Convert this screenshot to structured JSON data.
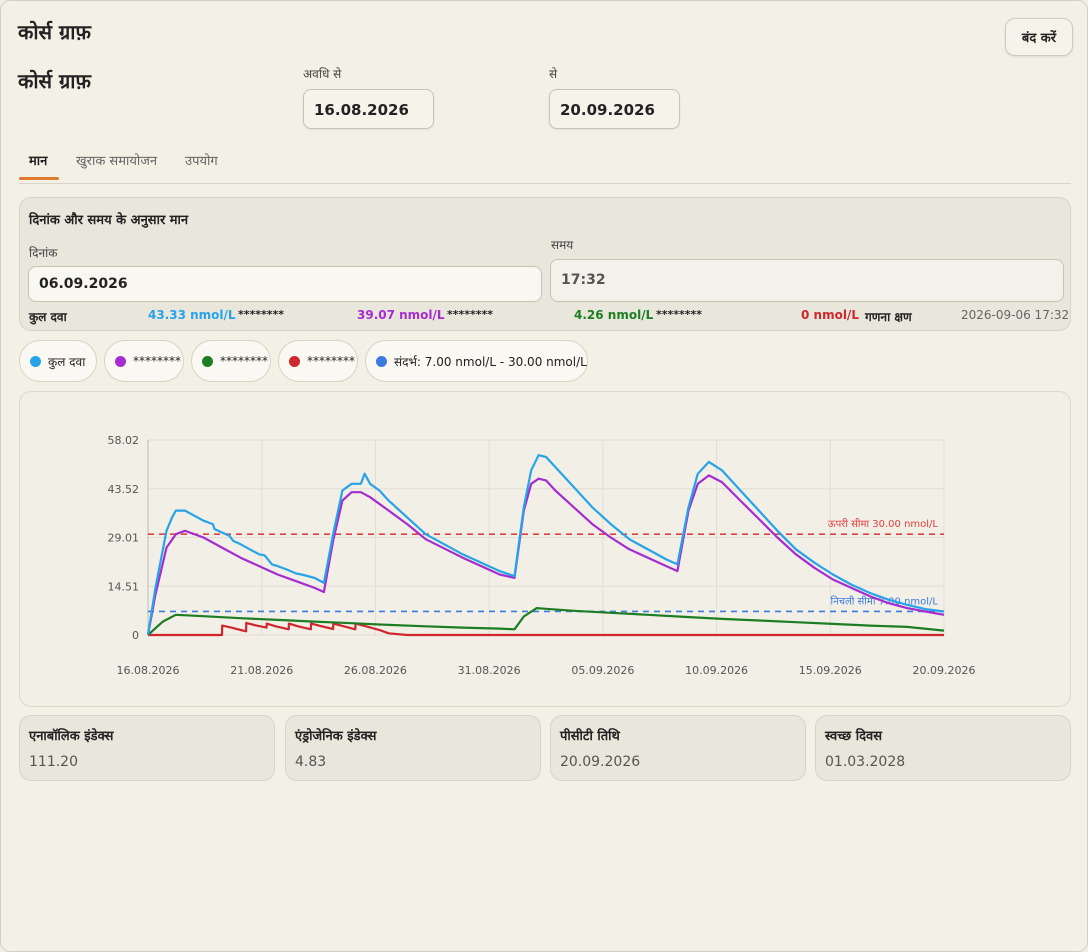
{
  "window": {
    "title": "कोर्स ग्राफ़",
    "close_label": "बंद करें"
  },
  "page_title": "कोर्स ग्राफ़",
  "period": {
    "from_label": "अवधि से",
    "from_value": "16.08.2026",
    "to_label": "से",
    "to_value": "20.09.2026"
  },
  "tabs": [
    {
      "label": "मान"
    },
    {
      "label": "खुराक समायोजन"
    },
    {
      "label": "उपयोग"
    }
  ],
  "values_panel": {
    "title": "दिनांक और समय के अनुसार मान",
    "date_label": "दिनांक",
    "date_value": "06.09.2026",
    "time_label": "समय",
    "time_value": "17:32",
    "total_label": "कुल दवा",
    "total_value": "43.33 nmol/L",
    "s1_name": "********",
    "s1_value": "39.07 nmol/L",
    "s2_name": "********",
    "s2_value": "4.26 nmol/L",
    "s3_name": "********",
    "s3_value": "0 nmol/L",
    "calc_label": "गणना क्षण",
    "calc_value": "2026-09-06 17:32"
  },
  "legend": [
    {
      "label": "कुल दवा",
      "color": "#27a3e8"
    },
    {
      "label": "********",
      "color": "#a52ccf"
    },
    {
      "label": "********",
      "color": "#1c7d23"
    },
    {
      "label": "********",
      "color": "#d0262d"
    },
    {
      "label": "संदर्भ: 7.00 nmol/L - 30.00 nmol/L",
      "color": "#3b7be0"
    }
  ],
  "chart_data": {
    "type": "line",
    "x_ticks": [
      "16.08.2026",
      "21.08.2026",
      "26.08.2026",
      "31.08.2026",
      "05.09.2026",
      "10.09.2026",
      "15.09.2026",
      "20.09.2026"
    ],
    "y_ticks": [
      "58.02",
      "43.52",
      "29.01",
      "14.51",
      "0"
    ],
    "ylim": [
      0,
      58.02
    ],
    "xlim_days": [
      0,
      36
    ],
    "upper_ref": {
      "value": 30.0,
      "label": "ऊपरी सीमा 30.00 nmol/L",
      "color": "#e04040"
    },
    "lower_ref": {
      "value": 7.0,
      "label": "निचली सीमा 7.00 nmol/L",
      "color": "#3b7be0"
    },
    "series": [
      {
        "name": "कुल दवा",
        "color": "#27a3e8",
        "points": [
          [
            0,
            0
          ],
          [
            0.4,
            14
          ],
          [
            1,
            31
          ],
          [
            1.3,
            35
          ],
          [
            1.5,
            37
          ],
          [
            2,
            37
          ],
          [
            3,
            34
          ],
          [
            3.5,
            33
          ],
          [
            3.6,
            31.5
          ],
          [
            4,
            30.5
          ],
          [
            4.4,
            29.5
          ],
          [
            4.6,
            28
          ],
          [
            5,
            27
          ],
          [
            5.5,
            25.5
          ],
          [
            6,
            24
          ],
          [
            6.3,
            23.7
          ],
          [
            6.7,
            21
          ],
          [
            7,
            20.5
          ],
          [
            7.5,
            19.5
          ],
          [
            8,
            18.3
          ],
          [
            8.3,
            18
          ],
          [
            9,
            17
          ],
          [
            9.5,
            15.5
          ],
          [
            10,
            30
          ],
          [
            10.5,
            43
          ],
          [
            11,
            45
          ],
          [
            11.5,
            45
          ],
          [
            11.7,
            48
          ],
          [
            12,
            45
          ],
          [
            12.5,
            43
          ],
          [
            13,
            40
          ],
          [
            14,
            35
          ],
          [
            15,
            30
          ],
          [
            17,
            24
          ],
          [
            19,
            19
          ],
          [
            19.8,
            17.5
          ],
          [
            20.3,
            38
          ],
          [
            20.7,
            49
          ],
          [
            21.1,
            53.5
          ],
          [
            21.5,
            53
          ],
          [
            22,
            50
          ],
          [
            23,
            44
          ],
          [
            24,
            38
          ],
          [
            25,
            33
          ],
          [
            26,
            28.5
          ],
          [
            28,
            22.5
          ],
          [
            28.6,
            21
          ],
          [
            29.2,
            38
          ],
          [
            29.7,
            48
          ],
          [
            30.3,
            51.5
          ],
          [
            31,
            49
          ],
          [
            32,
            43
          ],
          [
            33,
            37
          ],
          [
            34,
            31
          ],
          [
            35,
            25.5
          ],
          [
            36,
            21.5
          ],
          [
            37,
            18
          ],
          [
            38,
            15
          ],
          [
            39,
            12.5
          ],
          [
            40,
            10.5
          ],
          [
            41,
            9
          ],
          [
            42,
            7.7
          ],
          [
            43,
            7
          ]
        ]
      },
      {
        "name": "********",
        "color": "#a52ccf",
        "points": [
          [
            0,
            0
          ],
          [
            0.4,
            12
          ],
          [
            1,
            26
          ],
          [
            1.5,
            30
          ],
          [
            2,
            31
          ],
          [
            3,
            29
          ],
          [
            4,
            26
          ],
          [
            5,
            23
          ],
          [
            6,
            20.5
          ],
          [
            7,
            18
          ],
          [
            8,
            16
          ],
          [
            9,
            14
          ],
          [
            9.5,
            12.8
          ],
          [
            10,
            28
          ],
          [
            10.5,
            40
          ],
          [
            11,
            42.5
          ],
          [
            11.5,
            42.5
          ],
          [
            12,
            41
          ],
          [
            13,
            37
          ],
          [
            14,
            33
          ],
          [
            15,
            28.5
          ],
          [
            17,
            23
          ],
          [
            19,
            18
          ],
          [
            19.8,
            17
          ],
          [
            20.3,
            37
          ],
          [
            20.7,
            45
          ],
          [
            21.1,
            46.5
          ],
          [
            21.5,
            46
          ],
          [
            22,
            43
          ],
          [
            23,
            38
          ],
          [
            24,
            33
          ],
          [
            25,
            29
          ],
          [
            26,
            25.5
          ],
          [
            28,
            20.5
          ],
          [
            28.6,
            19
          ],
          [
            29.2,
            37
          ],
          [
            29.7,
            45
          ],
          [
            30.3,
            47.5
          ],
          [
            31,
            45.5
          ],
          [
            32,
            40
          ],
          [
            33,
            34.5
          ],
          [
            34,
            29
          ],
          [
            35,
            24
          ],
          [
            36,
            20
          ],
          [
            37,
            16.5
          ],
          [
            38,
            14
          ],
          [
            39,
            11.5
          ],
          [
            40,
            9.5
          ],
          [
            41,
            8
          ],
          [
            42,
            7
          ],
          [
            43,
            6
          ]
        ]
      },
      {
        "name": "********",
        "color": "#1c7d23",
        "points": [
          [
            0,
            0
          ],
          [
            0.8,
            4
          ],
          [
            1.5,
            6
          ],
          [
            3,
            5.6
          ],
          [
            5,
            5
          ],
          [
            7,
            4.5
          ],
          [
            9,
            4
          ],
          [
            11,
            3.5
          ],
          [
            13,
            3
          ],
          [
            15,
            2.6
          ],
          [
            17,
            2.2
          ],
          [
            19,
            1.9
          ],
          [
            19.8,
            1.7
          ],
          [
            20.3,
            5.5
          ],
          [
            21,
            8
          ],
          [
            21.5,
            7.8
          ],
          [
            23,
            7.2
          ],
          [
            25,
            6.6
          ],
          [
            27,
            6
          ],
          [
            29,
            5.4
          ],
          [
            31,
            4.8
          ],
          [
            33,
            4.3
          ],
          [
            35,
            3.8
          ],
          [
            37,
            3.3
          ],
          [
            39,
            2.8
          ],
          [
            41,
            2.4
          ],
          [
            43,
            1.3
          ]
        ]
      },
      {
        "name": "********",
        "color": "#d0262d",
        "points": [
          [
            0,
            0
          ],
          [
            4,
            0
          ],
          [
            4.01,
            2.8
          ],
          [
            4.5,
            2.2
          ],
          [
            5,
            1.5
          ],
          [
            5.3,
            1.1
          ],
          [
            5.31,
            3.6
          ],
          [
            5.8,
            2.9
          ],
          [
            6.4,
            2.2
          ],
          [
            6.41,
            3.4
          ],
          [
            6.9,
            2.6
          ],
          [
            7.6,
            1.7
          ],
          [
            7.61,
            3.4
          ],
          [
            8.1,
            2.6
          ],
          [
            8.8,
            1.7
          ],
          [
            8.81,
            3.4
          ],
          [
            9.3,
            2.7
          ],
          [
            10,
            1.8
          ],
          [
            10.01,
            3.4
          ],
          [
            10.5,
            2.7
          ],
          [
            11.2,
            1.7
          ],
          [
            11.21,
            3.4
          ],
          [
            11.7,
            2.7
          ],
          [
            12.5,
            1.5
          ],
          [
            13,
            0.5
          ],
          [
            14,
            0
          ],
          [
            43,
            0
          ]
        ]
      }
    ]
  },
  "stats": [
    {
      "title": "एनाबॉलिक इंडेक्स",
      "value": "111.20"
    },
    {
      "title": "एंड्रोजेनिक इंडेक्स",
      "value": "4.83"
    },
    {
      "title": "पीसीटी तिथि",
      "value": "20.09.2026"
    },
    {
      "title": "स्वच्छ दिवस",
      "value": "01.03.2028"
    }
  ]
}
